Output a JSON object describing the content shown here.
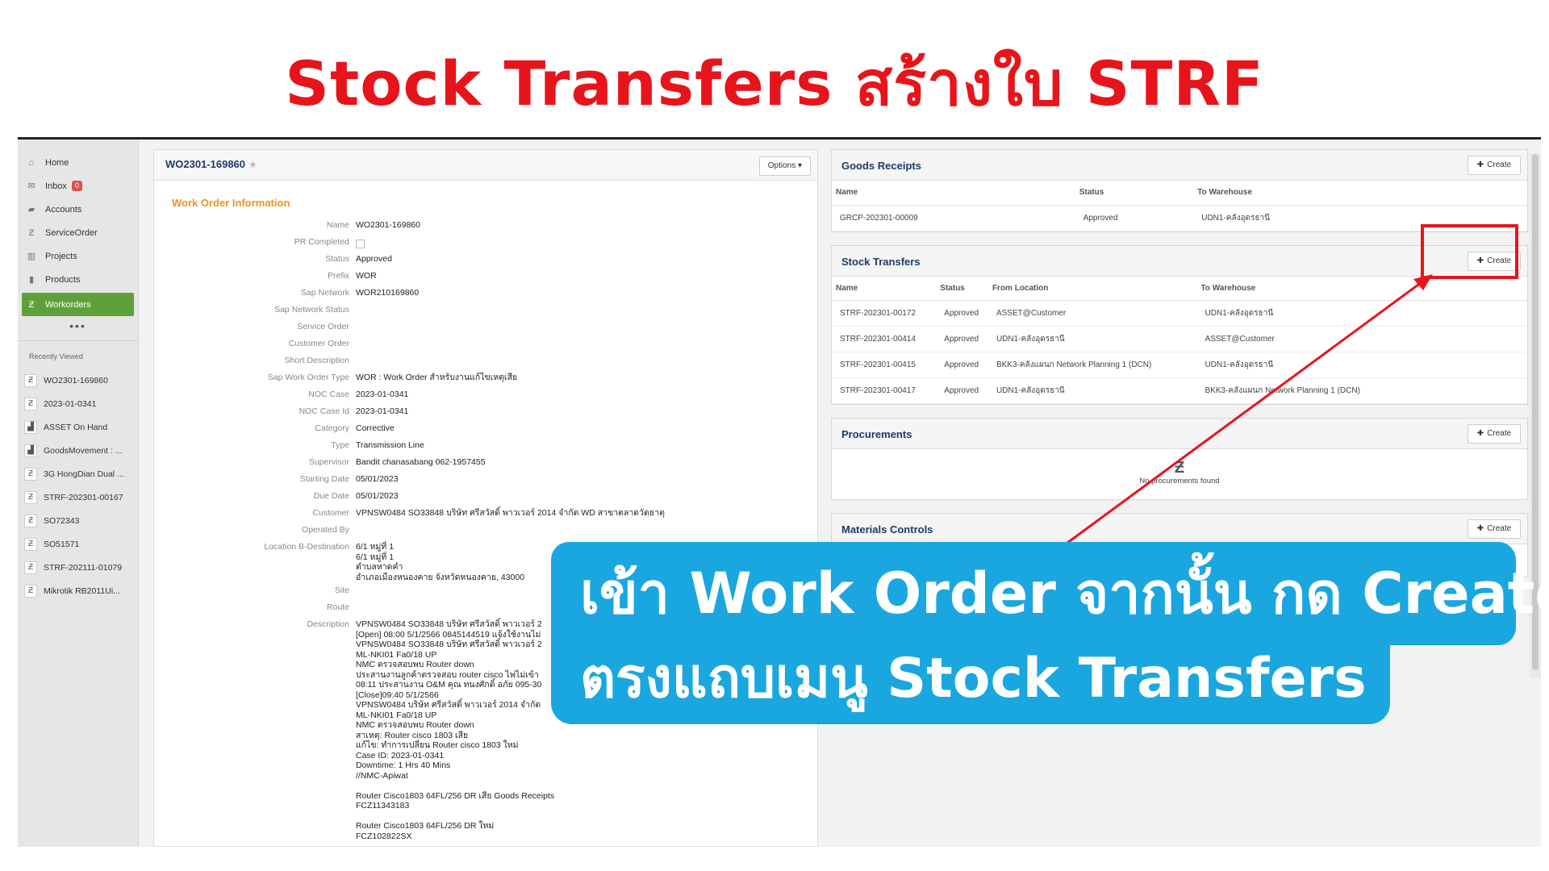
{
  "banner_title": "Stock Transfers สร้างใบ STRF",
  "sidebar": {
    "items": [
      {
        "label": "Home",
        "icon": "home-icon",
        "glyph": "⌂"
      },
      {
        "label": "Inbox",
        "icon": "inbox-icon",
        "glyph": "✉",
        "badge": "0"
      },
      {
        "label": "Accounts",
        "icon": "folder-icon",
        "glyph": "▰"
      },
      {
        "label": "ServiceOrder",
        "icon": "z-icon",
        "glyph": "Ƶ"
      },
      {
        "label": "Projects",
        "icon": "projects-icon",
        "glyph": "▥"
      },
      {
        "label": "Products",
        "icon": "products-icon",
        "glyph": "▮"
      },
      {
        "label": "Workorders",
        "icon": "z-icon",
        "glyph": "Ƶ",
        "active": true
      }
    ],
    "more": "•••",
    "recent_title": "Recently Viewed",
    "recent": [
      {
        "label": "WO2301-169860",
        "glyph": "Ƶ"
      },
      {
        "label": "2023-01-0341",
        "glyph": "Ƶ"
      },
      {
        "label": "ASSET On Hand",
        "glyph": "▟"
      },
      {
        "label": "GoodsMovement : ...",
        "glyph": "▟"
      },
      {
        "label": "3G HongDian Dual ...",
        "glyph": "Ƶ"
      },
      {
        "label": "STRF-202301-00167",
        "glyph": "Ƶ"
      },
      {
        "label": "SO72343",
        "glyph": "Ƶ"
      },
      {
        "label": "SO51571",
        "glyph": "Ƶ"
      },
      {
        "label": "STRF-202111-01079",
        "glyph": "Ƶ"
      },
      {
        "label": "Mikrotik RB2011Ui...",
        "glyph": "Ƶ"
      }
    ]
  },
  "work_order": {
    "title": "WO2301-169860",
    "star": "★",
    "options_label": "Options ▾",
    "section_title": "Work Order Information",
    "fields": [
      {
        "label": "Name",
        "value": "WO2301-169860"
      },
      {
        "label": "PR Completed",
        "value": "",
        "checkbox": true
      },
      {
        "label": "Status",
        "value": "Approved"
      },
      {
        "label": "Prefix",
        "value": "WOR"
      },
      {
        "label": "Sap Network",
        "value": "WOR210169860"
      },
      {
        "label": "Sap Network Status",
        "value": ""
      },
      {
        "label": "Service Order",
        "value": ""
      },
      {
        "label": "Customer Order",
        "value": ""
      },
      {
        "label": "Short Description",
        "value": ""
      },
      {
        "label": "Sap Work Order Type",
        "value": "WOR : Work Order สำหรับงานแก้ไขเหตุเสีย"
      },
      {
        "label": "NOC Case",
        "value": "2023-01-0341"
      },
      {
        "label": "NOC Case Id",
        "value": "2023-01-0341"
      },
      {
        "label": "Category",
        "value": "Corrective"
      },
      {
        "label": "Type",
        "value": "Transmission Line"
      },
      {
        "label": "Supervisor",
        "value": "Bandit chanasabang 062-1957455"
      },
      {
        "label": "Starting Date",
        "value": "05/01/2023"
      },
      {
        "label": "Due Date",
        "value": "05/01/2023"
      },
      {
        "label": "Customer",
        "value": "VPNSW0484 SO33848 บริษัท ศรีสวัสดิ์ พาวเวอร์ 2014 จำกัด WD สาขาตลาดวัดธาตุ"
      },
      {
        "label": "Operated By",
        "value": ""
      },
      {
        "label": "Location B-Destination",
        "value": "6/1 หมู่ที่ 1\n6/1 หมู่ที่ 1\nตำบลหาดคำ\nอำเภอเมืองหนองคาย จังหวัดหนองคาย, 43000",
        "multiline": true
      },
      {
        "label": "Site",
        "value": ""
      },
      {
        "label": "Route",
        "value": ""
      },
      {
        "label": "Description",
        "value": "VPNSW0484 SO33848 บริษัท ศรีสวัสดิ์ พาวเวอร์ 2\n[Open] 08:00 5/1/2566 0845144519 แจ้งใช้งานไม่\nVPNSW0484 SO33848 บริษัท ศรีสวัสดิ์ พาวเวอร์ 2\nML-NKI01 Fa0/18 UP\nNMC ตรวจสอบพบ Router down\nประสานงานลูกค้าตรวจสอบ router cisco ไฟไม่เข้า\n08:11 ประสานงาน O&M คุณ ทนงศักดิ์ อภัย 095-30\n[Close]09:40 5/1/2566\nVPNSW0484 บริษัท ศรีสวัสดิ์ พาวเวอร์ 2014 จำกัด\nML-NKI01 Fa0/18 UP\nNMC ตรวจสอบพบ Router down\nสาเหตุ: Router cisco 1803 เสีย\nแก้ไข: ทำการเปลี่ยน Router cisco 1803 ใหม่\nCase ID: 2023-01-0341\nDowntime: 1 Hrs 40 Mins\n//NMC-Apiwat\n\nRouter Cisco1803 64FL/256 DR เสีย Goods Receipts\nFCZ11343183\n\nRouter Cisco1803 64FL/256 DR ใหม่\nFCZ102822SX",
        "multiline": true
      }
    ]
  },
  "goods_receipts": {
    "title": "Goods Receipts",
    "create_label": "Create",
    "columns": [
      "Name",
      "Status",
      "To Warehouse"
    ],
    "rows": [
      [
        "GRCP-202301-00009",
        "Approved",
        "UDN1-คลังอุดรธานี"
      ]
    ]
  },
  "stock_transfers": {
    "title": "Stock Transfers",
    "create_label": "Create",
    "columns": [
      "Name",
      "Status",
      "From Location",
      "To Warehouse"
    ],
    "rows": [
      [
        "STRF-202301-00172",
        "Approved",
        "ASSET@Customer",
        "UDN1-คลังอุดรธานี"
      ],
      [
        "STRF-202301-00414",
        "Approved",
        "UDN1-คลังอุดรธานี",
        "ASSET@Customer"
      ],
      [
        "STRF-202301-00415",
        "Approved",
        "BKK3-คลังแผนก Network Planning 1 (DCN)",
        "UDN1-คลังอุดรธานี"
      ],
      [
        "STRF-202301-00417",
        "Approved",
        "UDN1-คลังอุดรธานี",
        "BKK3-คลังแผนก Network Planning 1 (DCN)"
      ]
    ]
  },
  "procurements": {
    "title": "Procurements",
    "create_label": "Create",
    "empty_icon": "Ƶ",
    "empty_text": "No procurements found"
  },
  "materials_controls": {
    "title": "Materials Controls",
    "create_label": "Create"
  },
  "callout": {
    "line1": "เข้า Work Order จากนั้น กด Create",
    "line2": "ตรงแถบเมนู Stock Transfers"
  },
  "colors": {
    "banner_red": "#e8141b",
    "callout_blue": "#1aa7e0",
    "active_green": "#5ea13a",
    "section_orange": "#e8961c"
  }
}
